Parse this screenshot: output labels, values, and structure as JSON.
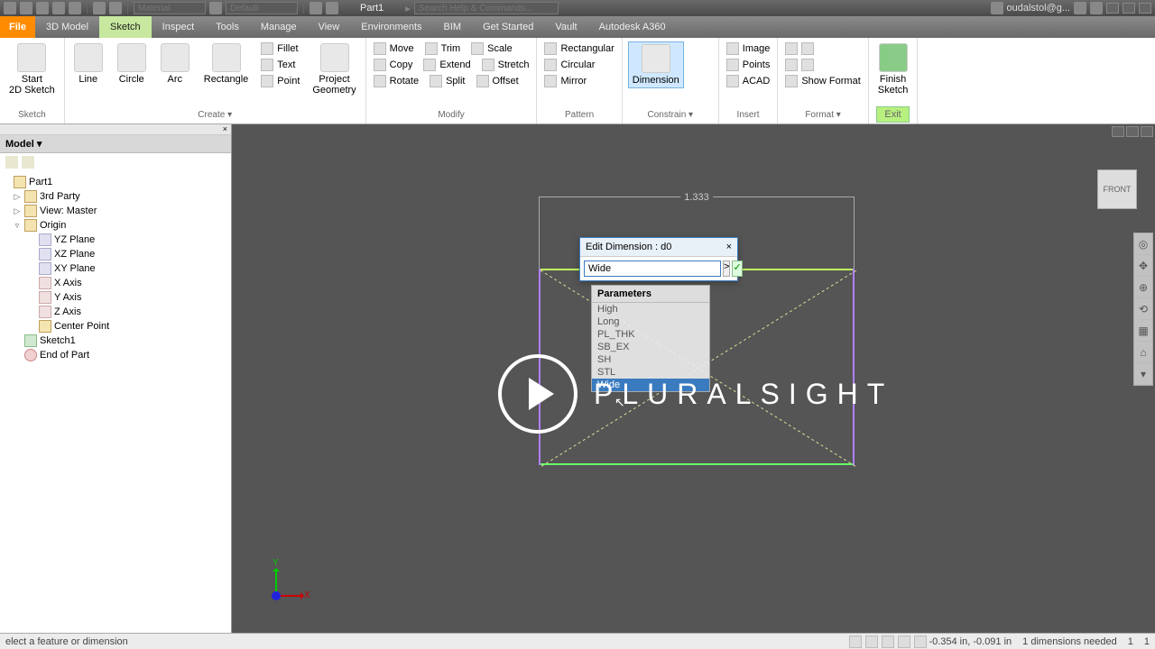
{
  "titlebar": {
    "material": "Material",
    "appearance": "Default",
    "part": "Part1",
    "search_ph": "Search Help & Commands...",
    "user": "oudalstol@g..."
  },
  "menu": {
    "file": "File",
    "tabs": [
      "3D Model",
      "Sketch",
      "Inspect",
      "Tools",
      "Manage",
      "View",
      "Environments",
      "BIM",
      "Get Started",
      "Vault",
      "Autodesk A360"
    ],
    "active": 1
  },
  "ribbon": {
    "sketch": {
      "start": "Start\n2D Sketch",
      "lbl": "Sketch"
    },
    "create": {
      "line": "Line",
      "circle": "Circle",
      "arc": "Arc",
      "rect": "Rectangle",
      "fillet": "Fillet",
      "text": "Text",
      "point": "Point",
      "geom": "Project\nGeometry",
      "lbl": "Create ▾"
    },
    "modify": {
      "move": "Move",
      "copy": "Copy",
      "rotate": "Rotate",
      "trim": "Trim",
      "extend": "Extend",
      "split": "Split",
      "scale": "Scale",
      "stretch": "Stretch",
      "offset": "Offset",
      "lbl": "Modify"
    },
    "pattern": {
      "rect": "Rectangular",
      "circ": "Circular",
      "mirror": "Mirror",
      "lbl": "Pattern"
    },
    "constrain": {
      "dim": "Dimension",
      "lbl": "Constrain ▾"
    },
    "insert": {
      "image": "Image",
      "points": "Points",
      "acad": "ACAD",
      "lbl": "Insert"
    },
    "format": {
      "show": "Show Format",
      "lbl": "Format ▾"
    },
    "exit": {
      "finish": "Finish\nSketch",
      "btn": "Exit"
    }
  },
  "browser": {
    "title": "Model ▾",
    "close": "×",
    "tree": [
      {
        "d": 0,
        "tw": "",
        "ic": "pt",
        "t": "Part1"
      },
      {
        "d": 1,
        "tw": "▷",
        "ic": "tp",
        "t": "3rd Party"
      },
      {
        "d": 1,
        "tw": "▷",
        "ic": "vw",
        "t": "View: Master"
      },
      {
        "d": 1,
        "tw": "▿",
        "ic": "or",
        "t": "Origin"
      },
      {
        "d": 2,
        "tw": "",
        "ic": "pl",
        "t": "YZ Plane"
      },
      {
        "d": 2,
        "tw": "",
        "ic": "pl",
        "t": "XZ Plane"
      },
      {
        "d": 2,
        "tw": "",
        "ic": "pl",
        "t": "XY Plane"
      },
      {
        "d": 2,
        "tw": "",
        "ic": "ax",
        "t": "X Axis"
      },
      {
        "d": 2,
        "tw": "",
        "ic": "ax",
        "t": "Y Axis"
      },
      {
        "d": 2,
        "tw": "",
        "ic": "ax",
        "t": "Z Axis"
      },
      {
        "d": 2,
        "tw": "",
        "ic": "cp",
        "t": "Center Point"
      },
      {
        "d": 1,
        "tw": "",
        "ic": "sk",
        "t": "Sketch1"
      },
      {
        "d": 1,
        "tw": "",
        "ic": "ep",
        "t": "End of Part"
      }
    ]
  },
  "canvas": {
    "dim": "1.333",
    "viewcube": "FRONT",
    "axis": {
      "x": "X",
      "y": "Y"
    }
  },
  "dialog": {
    "title": "Edit Dimension : d0",
    "close": "×",
    "value": "Wide",
    "arrow": ">",
    "ok": "✓"
  },
  "dropdown": {
    "header": "Parameters",
    "items": [
      "High",
      "Long",
      "PL_THK",
      "SB_EX",
      "SH",
      "STL"
    ],
    "sel": "Wide"
  },
  "status": {
    "prompt": "elect a feature or dimension",
    "coords": "-0.354 in, -0.091 in",
    "dims": "1 dimensions needed",
    "n1": "1",
    "n2": "1"
  },
  "overlay": {
    "brand": "PLURALSIGHT"
  }
}
